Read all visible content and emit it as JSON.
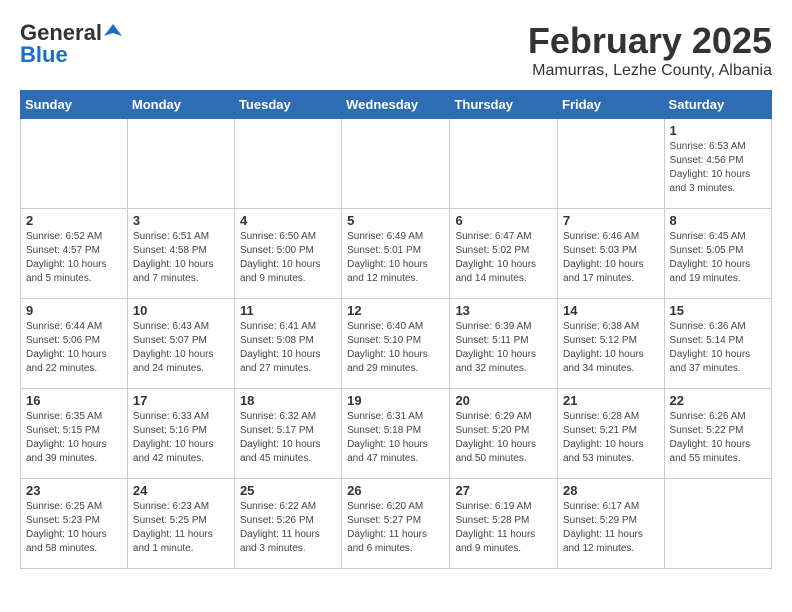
{
  "logo": {
    "general": "General",
    "blue": "Blue"
  },
  "title": "February 2025",
  "subtitle": "Mamurras, Lezhe County, Albania",
  "days_of_week": [
    "Sunday",
    "Monday",
    "Tuesday",
    "Wednesday",
    "Thursday",
    "Friday",
    "Saturday"
  ],
  "weeks": [
    [
      {
        "day": "",
        "info": ""
      },
      {
        "day": "",
        "info": ""
      },
      {
        "day": "",
        "info": ""
      },
      {
        "day": "",
        "info": ""
      },
      {
        "day": "",
        "info": ""
      },
      {
        "day": "",
        "info": ""
      },
      {
        "day": "1",
        "info": "Sunrise: 6:53 AM\nSunset: 4:56 PM\nDaylight: 10 hours and 3 minutes."
      }
    ],
    [
      {
        "day": "2",
        "info": "Sunrise: 6:52 AM\nSunset: 4:57 PM\nDaylight: 10 hours and 5 minutes."
      },
      {
        "day": "3",
        "info": "Sunrise: 6:51 AM\nSunset: 4:58 PM\nDaylight: 10 hours and 7 minutes."
      },
      {
        "day": "4",
        "info": "Sunrise: 6:50 AM\nSunset: 5:00 PM\nDaylight: 10 hours and 9 minutes."
      },
      {
        "day": "5",
        "info": "Sunrise: 6:49 AM\nSunset: 5:01 PM\nDaylight: 10 hours and 12 minutes."
      },
      {
        "day": "6",
        "info": "Sunrise: 6:47 AM\nSunset: 5:02 PM\nDaylight: 10 hours and 14 minutes."
      },
      {
        "day": "7",
        "info": "Sunrise: 6:46 AM\nSunset: 5:03 PM\nDaylight: 10 hours and 17 minutes."
      },
      {
        "day": "8",
        "info": "Sunrise: 6:45 AM\nSunset: 5:05 PM\nDaylight: 10 hours and 19 minutes."
      }
    ],
    [
      {
        "day": "9",
        "info": "Sunrise: 6:44 AM\nSunset: 5:06 PM\nDaylight: 10 hours and 22 minutes."
      },
      {
        "day": "10",
        "info": "Sunrise: 6:43 AM\nSunset: 5:07 PM\nDaylight: 10 hours and 24 minutes."
      },
      {
        "day": "11",
        "info": "Sunrise: 6:41 AM\nSunset: 5:08 PM\nDaylight: 10 hours and 27 minutes."
      },
      {
        "day": "12",
        "info": "Sunrise: 6:40 AM\nSunset: 5:10 PM\nDaylight: 10 hours and 29 minutes."
      },
      {
        "day": "13",
        "info": "Sunrise: 6:39 AM\nSunset: 5:11 PM\nDaylight: 10 hours and 32 minutes."
      },
      {
        "day": "14",
        "info": "Sunrise: 6:38 AM\nSunset: 5:12 PM\nDaylight: 10 hours and 34 minutes."
      },
      {
        "day": "15",
        "info": "Sunrise: 6:36 AM\nSunset: 5:14 PM\nDaylight: 10 hours and 37 minutes."
      }
    ],
    [
      {
        "day": "16",
        "info": "Sunrise: 6:35 AM\nSunset: 5:15 PM\nDaylight: 10 hours and 39 minutes."
      },
      {
        "day": "17",
        "info": "Sunrise: 6:33 AM\nSunset: 5:16 PM\nDaylight: 10 hours and 42 minutes."
      },
      {
        "day": "18",
        "info": "Sunrise: 6:32 AM\nSunset: 5:17 PM\nDaylight: 10 hours and 45 minutes."
      },
      {
        "day": "19",
        "info": "Sunrise: 6:31 AM\nSunset: 5:18 PM\nDaylight: 10 hours and 47 minutes."
      },
      {
        "day": "20",
        "info": "Sunrise: 6:29 AM\nSunset: 5:20 PM\nDaylight: 10 hours and 50 minutes."
      },
      {
        "day": "21",
        "info": "Sunrise: 6:28 AM\nSunset: 5:21 PM\nDaylight: 10 hours and 53 minutes."
      },
      {
        "day": "22",
        "info": "Sunrise: 6:26 AM\nSunset: 5:22 PM\nDaylight: 10 hours and 55 minutes."
      }
    ],
    [
      {
        "day": "23",
        "info": "Sunrise: 6:25 AM\nSunset: 5:23 PM\nDaylight: 10 hours and 58 minutes."
      },
      {
        "day": "24",
        "info": "Sunrise: 6:23 AM\nSunset: 5:25 PM\nDaylight: 11 hours and 1 minute."
      },
      {
        "day": "25",
        "info": "Sunrise: 6:22 AM\nSunset: 5:26 PM\nDaylight: 11 hours and 3 minutes."
      },
      {
        "day": "26",
        "info": "Sunrise: 6:20 AM\nSunset: 5:27 PM\nDaylight: 11 hours and 6 minutes."
      },
      {
        "day": "27",
        "info": "Sunrise: 6:19 AM\nSunset: 5:28 PM\nDaylight: 11 hours and 9 minutes."
      },
      {
        "day": "28",
        "info": "Sunrise: 6:17 AM\nSunset: 5:29 PM\nDaylight: 11 hours and 12 minutes."
      },
      {
        "day": "",
        "info": ""
      }
    ]
  ]
}
